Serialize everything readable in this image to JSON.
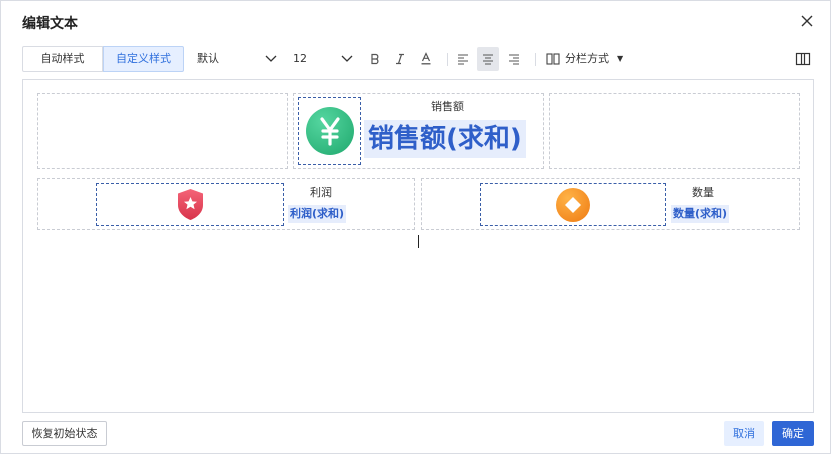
{
  "dialog": {
    "title": "编辑文本"
  },
  "toolbar": {
    "style_tabs": [
      "自动样式",
      "自定义样式"
    ],
    "font_select": {
      "value": "默认"
    },
    "size_select": {
      "value": "12"
    },
    "format_icons": [
      "bold-icon",
      "italic-icon",
      "font-color-icon"
    ],
    "align_icons": [
      "align-left-icon",
      "align-center-icon",
      "align-right-icon"
    ],
    "column_layout": {
      "label": "分栏方式"
    }
  },
  "editor": {
    "metrics": [
      {
        "title": "销售额",
        "value": "销售额(求和)",
        "icon": "yen-icon",
        "color": "#2fbd82"
      },
      {
        "title": "利润",
        "value": "利润(求和)",
        "icon": "star-shield-icon",
        "color": "#e8455b"
      },
      {
        "title": "数量",
        "value": "数量(求和)",
        "icon": "diamond-icon",
        "color": "#f08a1d"
      }
    ]
  },
  "footer": {
    "reset": "恢复初始状态",
    "cancel": "取消",
    "ok": "确定"
  }
}
